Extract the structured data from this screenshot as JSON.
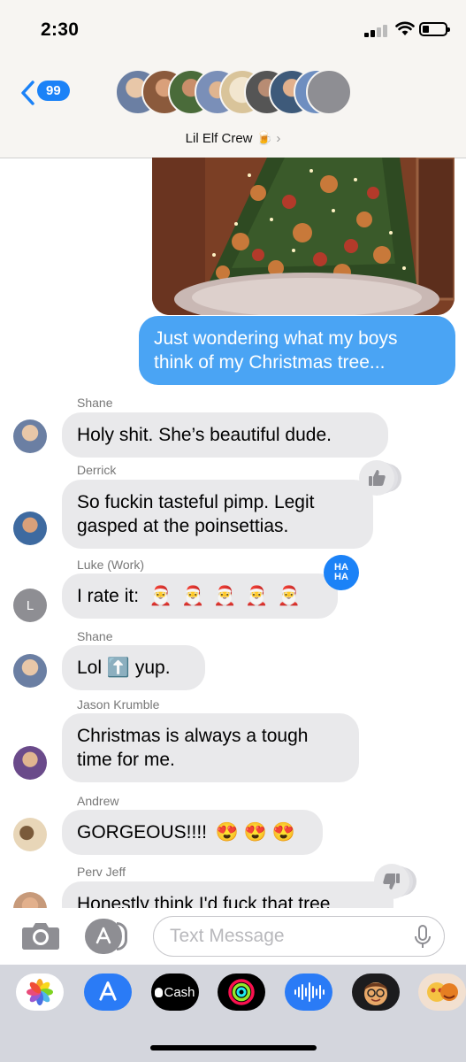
{
  "status_bar": {
    "time": "2:30"
  },
  "header": {
    "back_count": "99",
    "group_name": "Lil Elf Crew 🍺",
    "chevron": "›"
  },
  "messages": [
    {
      "type": "outgoing",
      "text": "Just wondering what my boys think of my Christmas tree..."
    },
    {
      "sender": "Shane",
      "text": "Holy shit. She’s beautiful dude."
    },
    {
      "sender": "Derrick",
      "text": "So fuckin tasteful pimp. Legit gasped at the poinsettias.",
      "tapback": "thumbs-up"
    },
    {
      "sender": "Luke (Work)",
      "text_prefix": "I rate it:",
      "emojis": [
        "🎅",
        "🎅",
        "🎅",
        "🎅",
        "🎅"
      ],
      "tapback": "haha",
      "avatar_letter": "L"
    },
    {
      "sender": "Shane",
      "text_a": "Lol",
      "emoji": "⬆️",
      "text_b": "yup."
    },
    {
      "sender": "Jason Krumble",
      "text": "Christmas is always a tough time for me."
    },
    {
      "sender": "Andrew",
      "text": "GORGEOUS!!!!",
      "emojis": [
        "😍",
        "😍",
        "😍"
      ]
    },
    {
      "sender": "Perv Jeff",
      "text": "Honestly think I'd fuck that tree",
      "tapback": "thumbs-down"
    }
  ],
  "composer": {
    "placeholder": "Text Message"
  },
  "app_drawer": {
    "cash_label": "Cash"
  },
  "colors": {
    "outgoing": "#4aa4f4",
    "incoming": "#e9e9eb",
    "accent": "#1b82f7"
  }
}
